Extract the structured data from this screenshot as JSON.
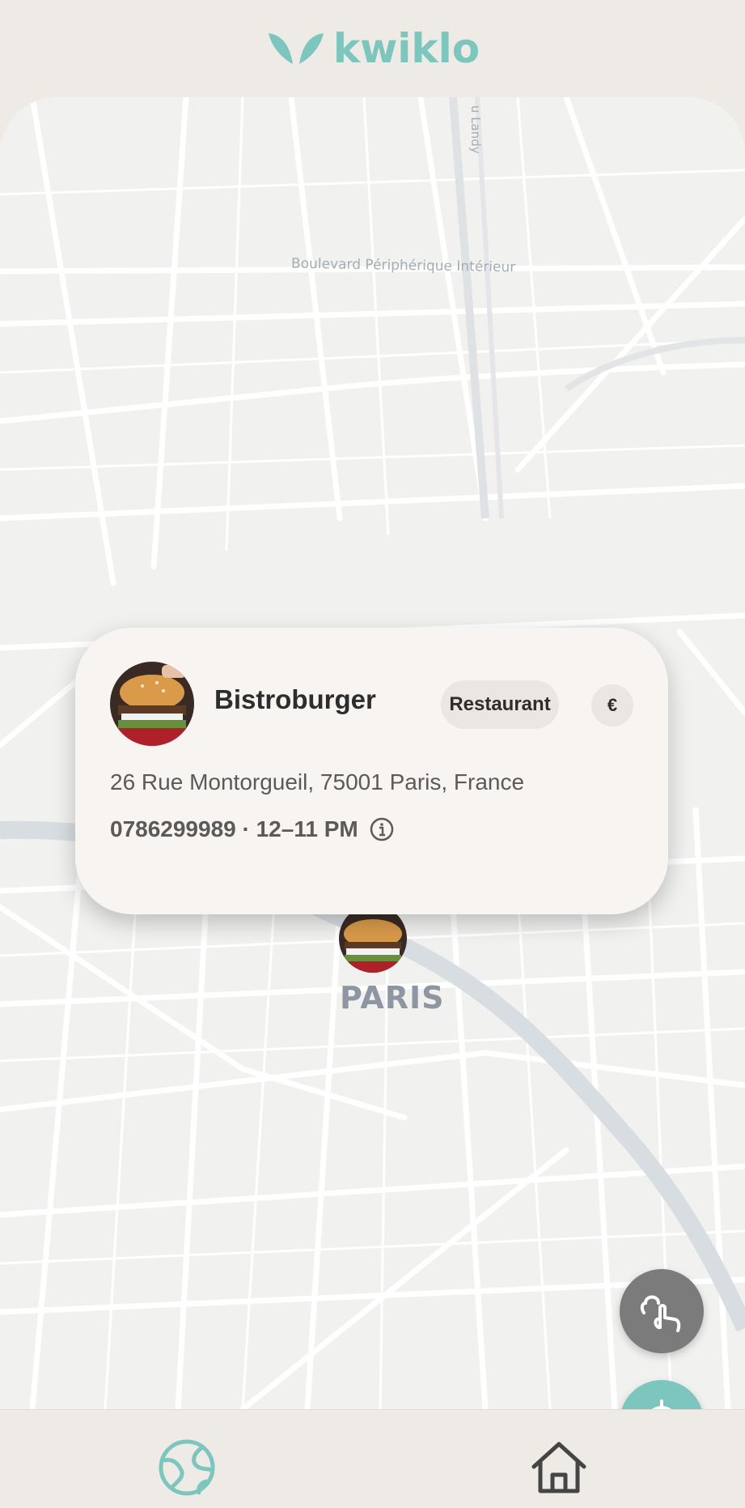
{
  "app": {
    "brand": "kwiklo",
    "brand_color": "#7cc6bd"
  },
  "map": {
    "labels": {
      "boulevard": "Boulevard Périphérique Intérieur",
      "landy": "u Landy",
      "city": "PARIS"
    }
  },
  "popup": {
    "name": "Bistroburger",
    "category": "Restaurant",
    "price": "€",
    "address": "26 Rue Montorgueil, 75001 Paris, France",
    "contact": "0786299989 · 12–11 PM",
    "info_icon": "info-icon"
  },
  "controls": {
    "gesture_icon": "gesture-tap-icon",
    "locate_icon": "crosshair-icon"
  },
  "nav": {
    "items": [
      {
        "icon": "globe-icon",
        "active": true
      },
      {
        "icon": "home-icon",
        "active": false
      }
    ]
  }
}
